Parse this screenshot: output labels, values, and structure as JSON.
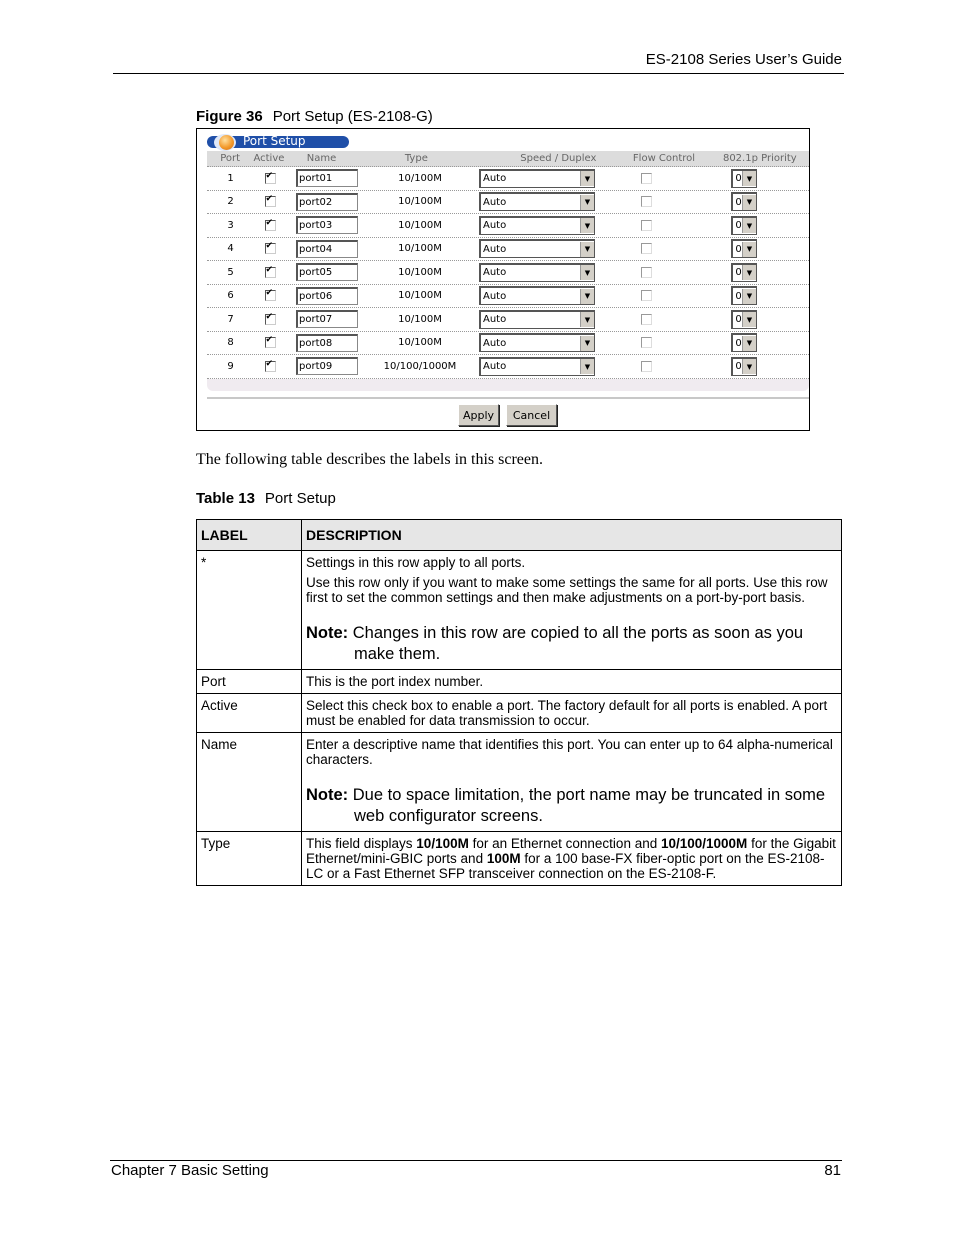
{
  "header": {
    "title": "ES-2108 Series User’s Guide"
  },
  "figure": {
    "number": "Figure 36",
    "caption": "Port Setup (ES-2108-G)",
    "panel_title": "Port Setup",
    "columns": [
      "Port",
      "Active",
      "Name",
      "Type",
      "Speed / Duplex",
      "Flow Control",
      "802.1p Priority"
    ],
    "rows": [
      {
        "port": "1",
        "active": true,
        "name": "port01",
        "type": "10/100M",
        "speed": "Auto",
        "flow": false,
        "priority": "0"
      },
      {
        "port": "2",
        "active": true,
        "name": "port02",
        "type": "10/100M",
        "speed": "Auto",
        "flow": false,
        "priority": "0"
      },
      {
        "port": "3",
        "active": true,
        "name": "port03",
        "type": "10/100M",
        "speed": "Auto",
        "flow": false,
        "priority": "0"
      },
      {
        "port": "4",
        "active": true,
        "name": "port04",
        "type": "10/100M",
        "speed": "Auto",
        "flow": false,
        "priority": "0"
      },
      {
        "port": "5",
        "active": true,
        "name": "port05",
        "type": "10/100M",
        "speed": "Auto",
        "flow": false,
        "priority": "0"
      },
      {
        "port": "6",
        "active": true,
        "name": "port06",
        "type": "10/100M",
        "speed": "Auto",
        "flow": false,
        "priority": "0"
      },
      {
        "port": "7",
        "active": true,
        "name": "port07",
        "type": "10/100M",
        "speed": "Auto",
        "flow": false,
        "priority": "0"
      },
      {
        "port": "8",
        "active": true,
        "name": "port08",
        "type": "10/100M",
        "speed": "Auto",
        "flow": false,
        "priority": "0"
      },
      {
        "port": "9",
        "active": true,
        "name": "port09",
        "type": "10/100/1000M",
        "speed": "Auto",
        "flow": false,
        "priority": "0"
      }
    ],
    "apply_label": "Apply",
    "cancel_label": "Cancel"
  },
  "body_text": "The following table describes the labels in this screen.",
  "table": {
    "number": "Table 13",
    "caption": "Port Setup",
    "headers": {
      "label": "LABEL",
      "description": "DESCRIPTION"
    },
    "rows": {
      "all": {
        "label": "*",
        "p1": "Settings in this row apply to all ports.",
        "p2": "Use this row only if you want to make some settings the same for all ports. Use this row first to set the common settings and then make adjustments on a port-by-port basis.",
        "note_label": "Note:",
        "note": "Changes in this row are copied to all the ports as soon as you make them."
      },
      "port": {
        "label": "Port",
        "p1": "This is the port index number."
      },
      "active": {
        "label": "Active",
        "p1": "Select this check box to enable a port. The factory default for all ports is enabled. A port must be enabled for data transmission to occur."
      },
      "name": {
        "label": "Name",
        "p1": "Enter a descriptive name that identifies this port. You can enter up to 64 alpha-numerical characters.",
        "note_label": "Note:",
        "note": "Due to space limitation, the port name may be truncated in some web configurator screens."
      },
      "type": {
        "label": "Type",
        "t1": "This field displays ",
        "b1": "10/100M",
        "t2": " for an Ethernet connection and ",
        "b2": "10/100/1000M",
        "t3": " for the Gigabit Ethernet/mini-GBIC ports and ",
        "b3": "100M",
        "t4": " for a 100 base-FX fiber-optic port on the ES-2108-LC or a Fast Ethernet SFP transceiver connection on the ES-2108-F."
      }
    }
  },
  "footer": {
    "chapter": "Chapter 7 Basic Setting",
    "page": "81"
  }
}
